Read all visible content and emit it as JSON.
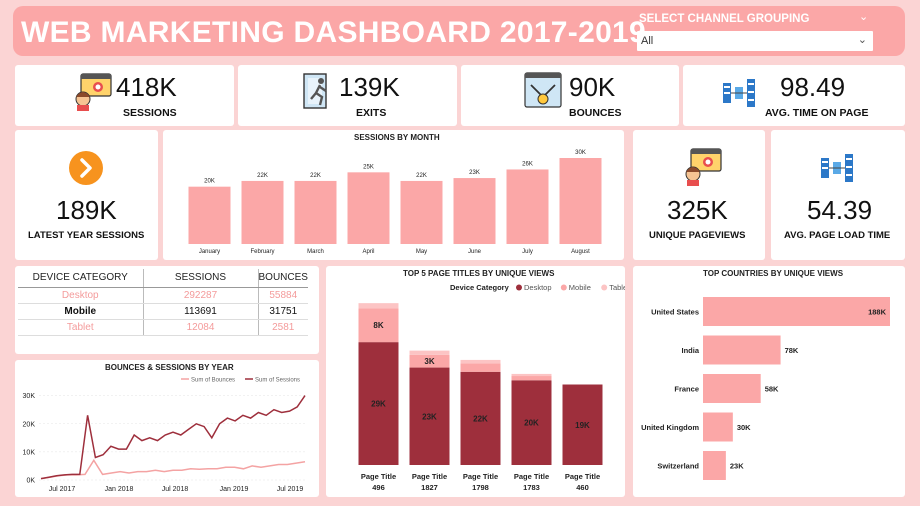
{
  "header": {
    "title": "WEB MARKETING DASHBOARD 2017-2019",
    "select_label": "SELECT CHANNEL GROUPING",
    "select_value": "All"
  },
  "kpis": {
    "sessions": {
      "value": "418K",
      "label": "SESSIONS",
      "icon": "browser-user-icon"
    },
    "exits": {
      "value": "139K",
      "label": "EXITS",
      "icon": "exit-door-icon"
    },
    "bounces": {
      "value": "90K",
      "label": "BOUNCES",
      "icon": "bounce-icon"
    },
    "avg_time": {
      "value": "98.49",
      "label": "AVG. TIME ON PAGE",
      "icon": "servers-icon"
    },
    "latest_year": {
      "value": "189K",
      "label": "LATEST YEAR SESSIONS",
      "icon": "arrow-circle-icon"
    },
    "unique_pageviews": {
      "value": "325K",
      "label": "UNIQUE PAGEVIEWS",
      "icon": "browser-user-icon"
    },
    "avg_load": {
      "value": "54.39",
      "label": "AVG. PAGE LOAD TIME",
      "icon": "servers-icon"
    }
  },
  "device_table": {
    "headers": [
      "DEVICE CATEGORY",
      "SESSIONS",
      "BOUNCES"
    ],
    "rows": [
      {
        "category": "Desktop",
        "sessions": "292287",
        "bounces": "55884"
      },
      {
        "category": "Mobile",
        "sessions": "113691",
        "bounces": "31751"
      },
      {
        "category": "Tablet",
        "sessions": "12084",
        "bounces": "2581"
      }
    ]
  },
  "colors": {
    "pink": "#fba7a7",
    "light_pink": "#fcc4c4",
    "dark_red": "#9e2f3c",
    "background": "#fbd4d4"
  },
  "chart_data": [
    {
      "type": "bar",
      "title": "SESSIONS BY MONTH",
      "categories": [
        "January",
        "February",
        "March",
        "April",
        "May",
        "June",
        "July",
        "August"
      ],
      "values": [
        20,
        22,
        22,
        25,
        22,
        23,
        26,
        30
      ],
      "labels": [
        "20K",
        "22K",
        "22K",
        "25K",
        "22K",
        "23K",
        "26K",
        "30K"
      ],
      "ylim": [
        0,
        30
      ]
    },
    {
      "type": "bar",
      "title": "TOP 5 PAGE TITLES BY UNIQUE VIEWS",
      "legend_title": "Device Category",
      "categories": [
        "Page Title 496",
        "Page Title 1827",
        "Page Title 1798",
        "Page Title 1783",
        "Page Title 460"
      ],
      "category_lines": [
        [
          "Page Title",
          "496"
        ],
        [
          "Page Title",
          "1827"
        ],
        [
          "Page Title",
          "1798"
        ],
        [
          "Page Title",
          "1783"
        ],
        [
          "Page Title",
          "460"
        ]
      ],
      "series": [
        {
          "name": "Desktop",
          "values": [
            29,
            23,
            22,
            20,
            19
          ],
          "labels": [
            "29K",
            "23K",
            "22K",
            "20K",
            "19K"
          ],
          "color": "#9e2f3c"
        },
        {
          "name": "Mobile",
          "values": [
            8,
            3,
            2,
            1,
            0
          ],
          "labels": [
            "8K",
            "3K",
            "",
            "",
            ""
          ],
          "color": "#fba7a7"
        },
        {
          "name": "Tablet",
          "values": [
            1.2,
            1,
            0.8,
            0.5,
            0
          ],
          "labels": [
            "",
            "",
            "",
            "",
            ""
          ],
          "color": "#fcc4c4"
        }
      ],
      "stacked": true,
      "ylim": [
        0,
        38
      ]
    },
    {
      "type": "bar",
      "title": "TOP COUNTRIES BY UNIQUE VIEWS",
      "orientation": "horizontal",
      "categories": [
        "United States",
        "India",
        "France",
        "United Kingdom",
        "Switzerland"
      ],
      "values": [
        188,
        78,
        58,
        30,
        23
      ],
      "labels": [
        "188K",
        "78K",
        "58K",
        "30K",
        "23K"
      ],
      "xlim": [
        0,
        188
      ]
    },
    {
      "type": "line",
      "title": "BOUNCES & SESSIONS BY YEAR",
      "x_ticks": [
        "Jul 2017",
        "Jan 2018",
        "Jul 2018",
        "Jan 2019",
        "Jul 2019"
      ],
      "y_ticks": [
        "0K",
        "10K",
        "20K",
        "30K"
      ],
      "ylim": [
        0,
        32
      ],
      "series": [
        {
          "name": "Sum of Bounces",
          "color": "#f4a3a3",
          "values": [
            0.5,
            1,
            1.5,
            1.8,
            1.8,
            2,
            7,
            2,
            2.5,
            3,
            2.5,
            3,
            3,
            3.5,
            3,
            3.5,
            3.5,
            4,
            3.8,
            4,
            4,
            4.5,
            4.5,
            4,
            5,
            4.5,
            5,
            5.5,
            5.5,
            6,
            6.5
          ]
        },
        {
          "name": "Sum of Sessions",
          "color": "#9e2f3c",
          "values": [
            0.5,
            1,
            1.5,
            1.8,
            2,
            2,
            23,
            8,
            9,
            12,
            11,
            11,
            16,
            14,
            15,
            14,
            16,
            17,
            16,
            18,
            20,
            19,
            15,
            20,
            22,
            21,
            23,
            22,
            24,
            23,
            25,
            24,
            24.5,
            26,
            30
          ]
        }
      ]
    }
  ]
}
